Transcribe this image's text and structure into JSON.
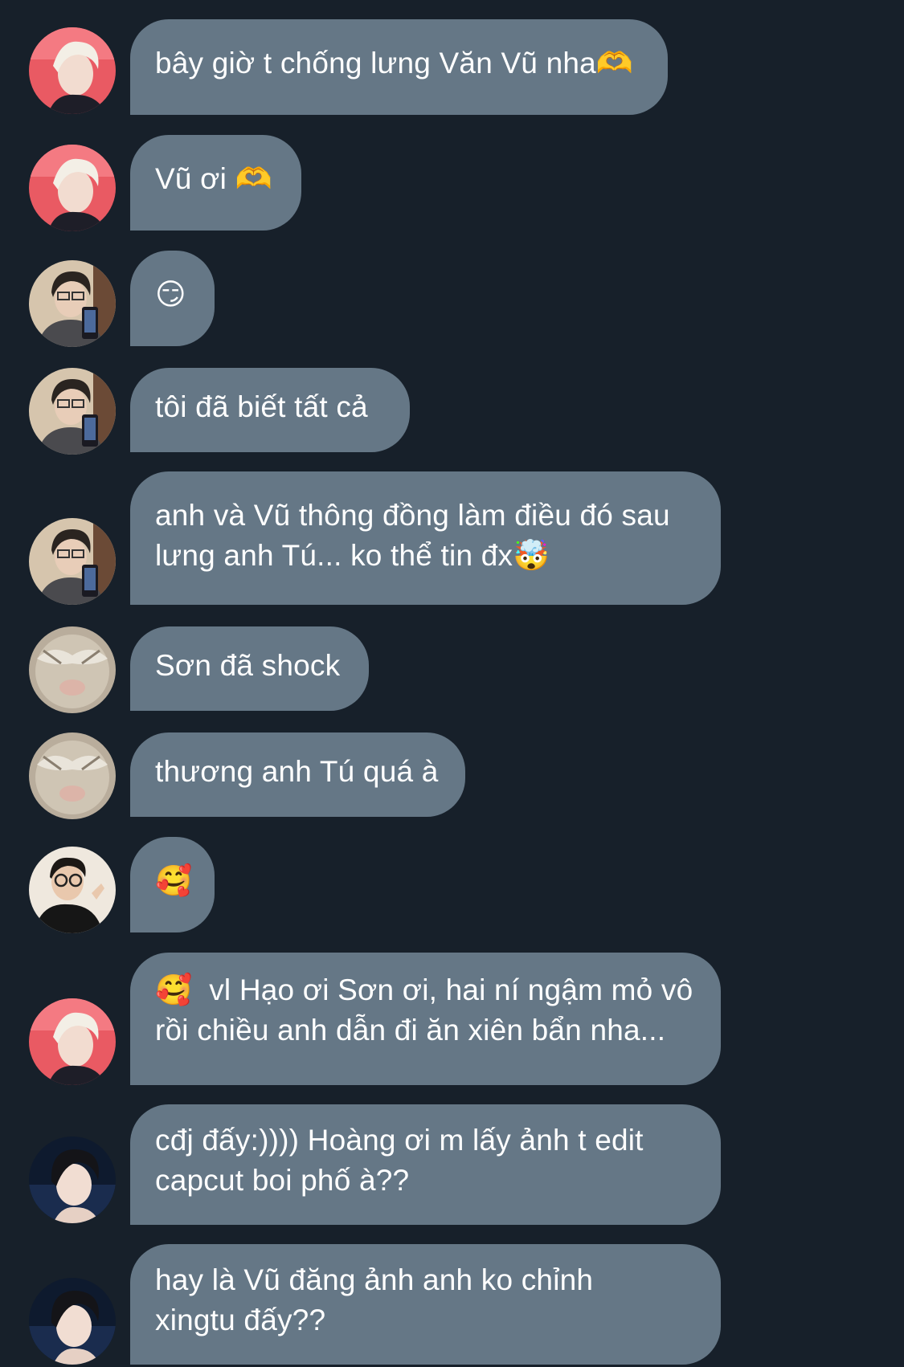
{
  "messages": [
    {
      "sender": "pink-hair-user",
      "text": "bây giờ t chống lưng Văn Vũ nha🫶"
    },
    {
      "sender": "pink-hair-user",
      "text": "Vũ ơi 🫶"
    },
    {
      "sender": "selfie-user",
      "text": "😏"
    },
    {
      "sender": "selfie-user",
      "text": "tôi đã biết tất cả"
    },
    {
      "sender": "selfie-user",
      "text": "anh và Vũ thông đồng làm điều đó sau\nlưng anh Tú... ko thể tin đx🤯"
    },
    {
      "sender": "mask-user",
      "text": "Sơn đã shock"
    },
    {
      "sender": "mask-user",
      "text": "thương anh Tú quá à"
    },
    {
      "sender": "glasses-user",
      "text": "🥰"
    },
    {
      "sender": "pink-hair-user",
      "text": "🥰  vl Hạo ơi Sơn ơi, hai ní ngậm mỏ vô\nrồi chiều anh dẫn đi ăn xiên bẩn nha..."
    },
    {
      "sender": "dark-hair-user",
      "text": "cđj đấy:)))) Hoàng ơi m lấy ảnh t edit\ncapcut boi phố à??"
    },
    {
      "sender": "dark-hair-user",
      "text": "hay là Vũ đăng ảnh anh ko chỉnh\nxingtu đấy??"
    }
  ],
  "colors": {
    "background": "#17202a",
    "bubble": "#657786",
    "text": "#ffffff"
  }
}
